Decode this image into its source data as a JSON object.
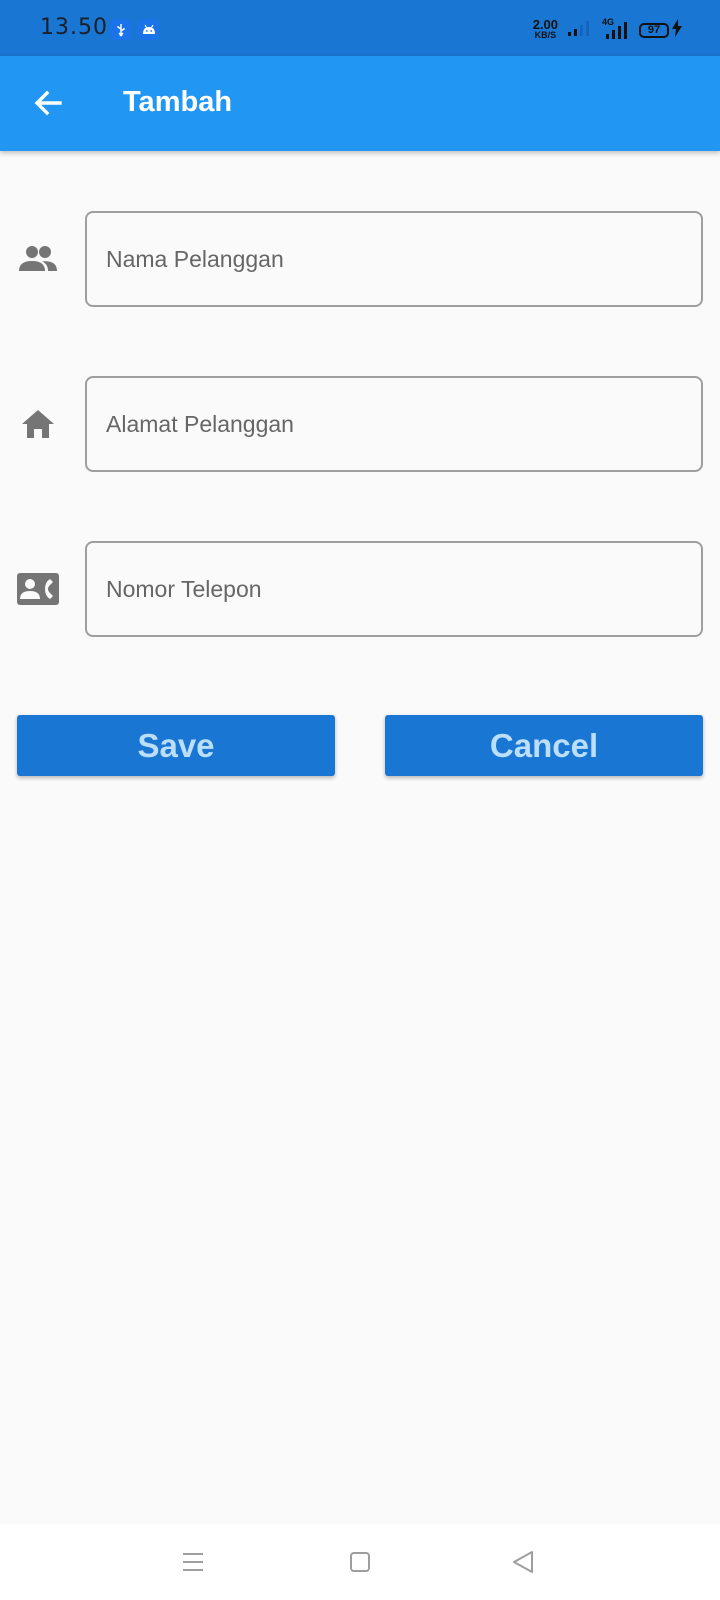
{
  "status_bar": {
    "time": "13.50",
    "net_speed_value": "2.00",
    "net_speed_unit": "KB/S",
    "network_label": "4G",
    "battery_level": "97",
    "notification_icons": [
      "usb-icon",
      "android-icon"
    ]
  },
  "app_bar": {
    "title": "Tambah",
    "back_icon": "arrow-back-icon",
    "background_color": "#2196f3"
  },
  "form": {
    "fields": [
      {
        "icon": "people-icon",
        "placeholder": "Nama Pelanggan",
        "value": ""
      },
      {
        "icon": "home-icon",
        "placeholder": "Alamat Pelanggan",
        "value": ""
      },
      {
        "icon": "contact-phone-icon",
        "placeholder": "Nomor Telepon",
        "value": ""
      }
    ]
  },
  "buttons": {
    "save_label": "Save",
    "cancel_label": "Cancel",
    "color": "#1976d2"
  },
  "nav_bar": {
    "icons": [
      "menu-icon",
      "home-square-icon",
      "back-triangle-icon"
    ]
  }
}
